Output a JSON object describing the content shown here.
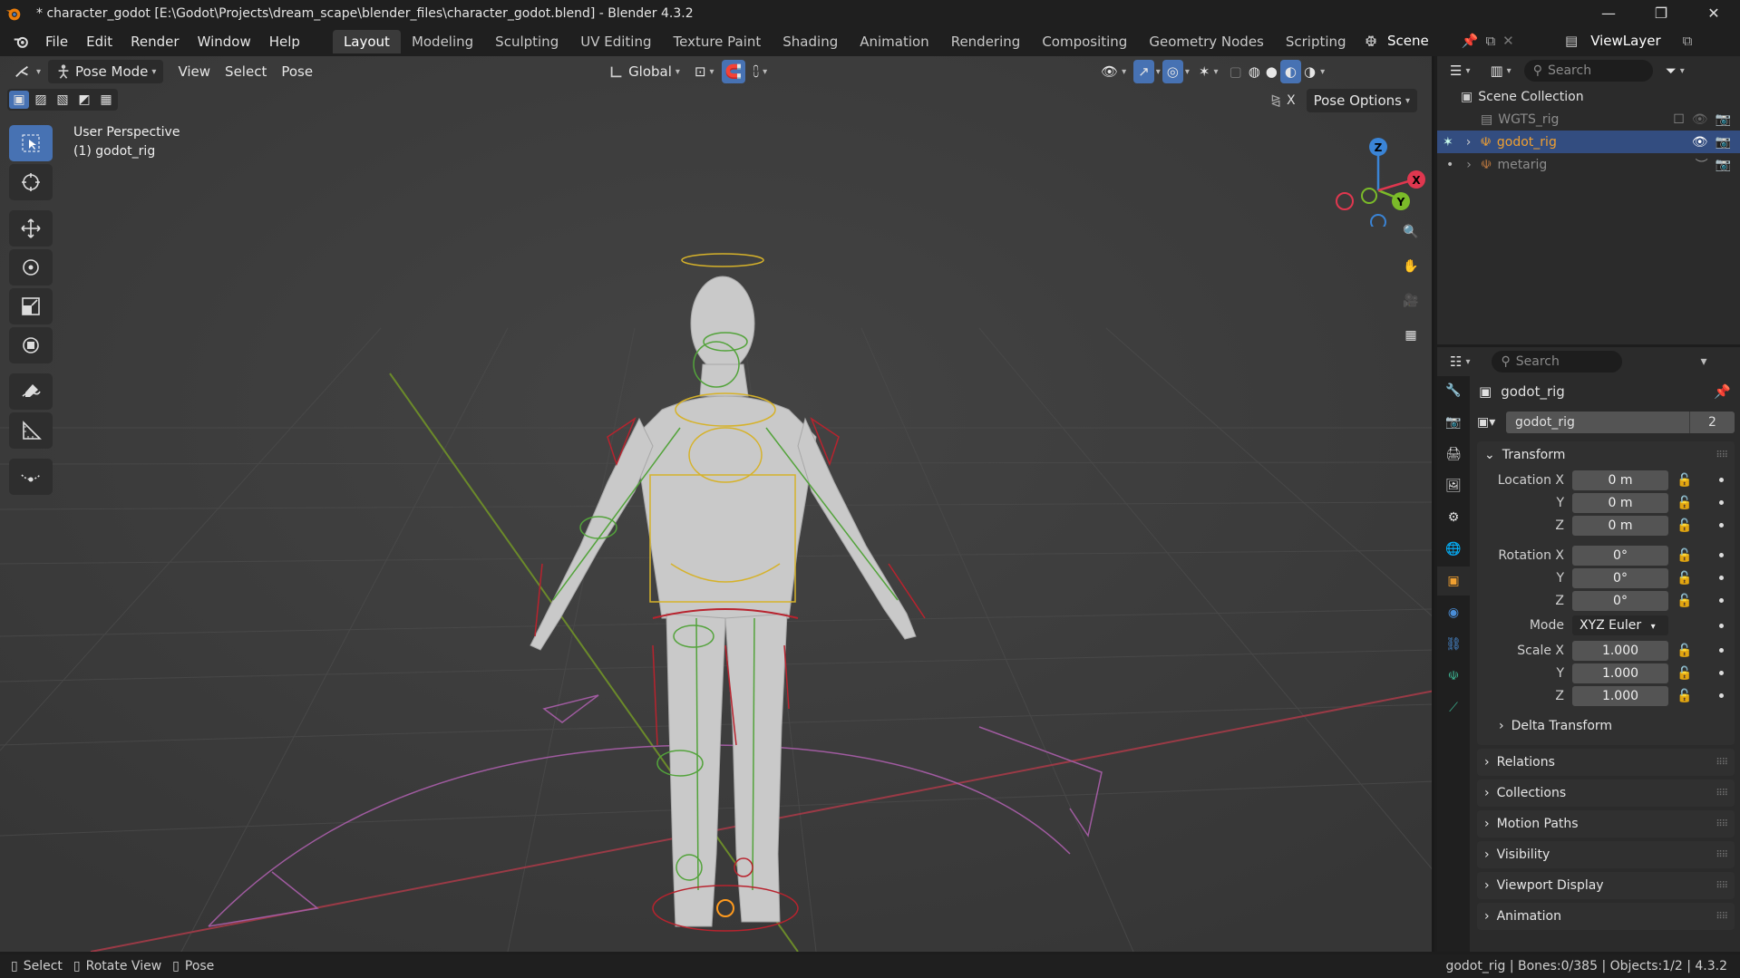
{
  "window": {
    "title": "* character_godot [E:\\Godot\\Projects\\dream_scape\\blender_files\\character_godot.blend] - Blender 4.3.2",
    "minimize": "—",
    "maximize": "❐",
    "close": "✕"
  },
  "menus": [
    "File",
    "Edit",
    "Render",
    "Window",
    "Help"
  ],
  "workspaces": [
    "Layout",
    "Modeling",
    "Sculpting",
    "UV Editing",
    "Texture Paint",
    "Shading",
    "Animation",
    "Rendering",
    "Compositing",
    "Geometry Nodes",
    "Scripting"
  ],
  "active_workspace": "Layout",
  "scene": {
    "name": "Scene",
    "view_layer": "ViewLayer"
  },
  "viewport_header": {
    "mode": "Pose Mode",
    "menus": [
      "View",
      "Select",
      "Pose"
    ],
    "orientation": "Global"
  },
  "viewport": {
    "perspective": "User Perspective",
    "active_object": "(1) godot_rig",
    "pose_options": "Pose Options",
    "x_mirror": "X",
    "gizmo_axes": {
      "x": "X",
      "y": "Y",
      "z": "Z"
    },
    "accent_x": "#e0374f",
    "accent_y": "#7bbb29",
    "accent_z": "#3a84d6"
  },
  "outliner": {
    "search_placeholder": "Search",
    "root": "Scene Collection",
    "items": [
      {
        "label": "WGTS_rig",
        "dimmed": true,
        "selected": false
      },
      {
        "label": "godot_rig",
        "dimmed": false,
        "selected": true
      },
      {
        "label": "metarig",
        "dimmed": true,
        "selected": false
      }
    ]
  },
  "properties": {
    "search_placeholder": "Search",
    "object_name": "godot_rig",
    "data_name": "godot_rig",
    "users": "2",
    "transform": {
      "title": "Transform",
      "location_label": "Location X",
      "rotation_label": "Rotation X",
      "scale_label": "Scale X",
      "y": "Y",
      "z": "Z",
      "location": [
        "0 m",
        "0 m",
        "0 m"
      ],
      "rotation": [
        "0°",
        "0°",
        "0°"
      ],
      "mode_label": "Mode",
      "mode": "XYZ Euler",
      "scale": [
        "1.000",
        "1.000",
        "1.000"
      ]
    },
    "delta": "Delta Transform",
    "sections": [
      "Relations",
      "Collections",
      "Motion Paths",
      "Visibility",
      "Viewport Display",
      "Animation"
    ]
  },
  "statusbar": {
    "hints": [
      "Select",
      "Rotate View",
      "Pose"
    ],
    "info": "godot_rig | Bones:0/385 | Objects:1/2 | 4.3.2"
  }
}
